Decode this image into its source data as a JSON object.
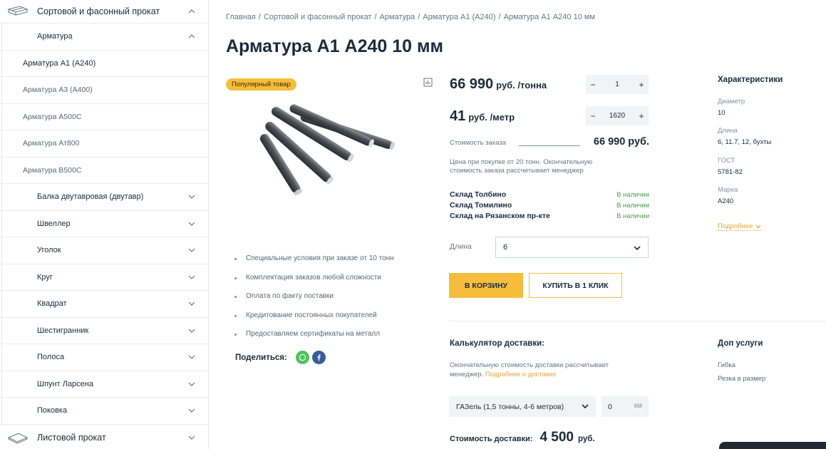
{
  "sidebar": {
    "top_category": "Сортовой и фасонный прокат",
    "sub_open": "Арматура",
    "leaf_items": [
      {
        "label": "Арматура А1 (А240)"
      },
      {
        "label": "Арматура А3 (А400)"
      },
      {
        "label": "Арматура А500С"
      },
      {
        "label": "Арматура Ат800"
      },
      {
        "label": "Арматура В500С"
      }
    ],
    "sub_items": [
      {
        "label": "Балка двутавровая (двутавр)"
      },
      {
        "label": "Швеллер"
      },
      {
        "label": "Уголок"
      },
      {
        "label": "Круг"
      },
      {
        "label": "Квадрат"
      },
      {
        "label": "Шестигранник"
      },
      {
        "label": "Полоса"
      },
      {
        "label": "Шпунт Ларсена"
      },
      {
        "label": "Поковка"
      }
    ],
    "bottom_category": "Листовой прокат"
  },
  "breadcrumbs": [
    "Главная",
    "Сортовой и фасонный прокат",
    "Арматура",
    "Арматура А1 (А240)",
    "Арматура А1 А240 10 мм"
  ],
  "breadcrumb_sep": "/",
  "product": {
    "title": "Арматура А1 А240 10 мм",
    "badge": "Популярный товар",
    "bullets": [
      "Специальные условия при заказе от 10 тонн",
      "Комплектация заказов любой сложности",
      "Оплата по факту поставки",
      "Кредитование постоянных покупателей",
      "Предоставляем сертификаты на металл"
    ],
    "share_label": "Поделиться:"
  },
  "pricing": {
    "price_ton": "66 990",
    "price_ton_unit": "руб. /тонна",
    "price_meter": "41",
    "price_meter_unit": "руб. /метр",
    "qty_ton": "1",
    "qty_meter": "1620",
    "minus": "−",
    "plus": "+",
    "order_cost_label": "Стоимость заказа",
    "order_cost_value": "66 990 руб.",
    "note": "Цена при покупке от 20 тонн. Окончательную стоимость заказа рассчитывает менеджер"
  },
  "stock": [
    {
      "name": "Склад Толбино",
      "status": "В наличии"
    },
    {
      "name": "Склад Томилино",
      "status": "В наличии"
    },
    {
      "name": "Склад на Рязанском пр-кте",
      "status": "В наличии"
    }
  ],
  "length": {
    "label": "Длина",
    "value": "6"
  },
  "actions": {
    "cart": "В КОРЗИНУ",
    "one_click": "КУПИТЬ В 1 КЛИК"
  },
  "specs": {
    "title": "Характеристики",
    "items": [
      {
        "k": "Диаметр",
        "v": "10"
      },
      {
        "k": "Длина",
        "v": "6, 11.7, 12, бухты"
      },
      {
        "k": "ГОСТ",
        "v": "5781-82"
      },
      {
        "k": "Марка",
        "v": "А240"
      }
    ],
    "more": "Подробнее"
  },
  "delivery": {
    "title": "Калькулятор доставки:",
    "note": "Окончательную стоимость доставки рассчитывает менеджер.",
    "note_link": "Подробнее о доставке",
    "vehicle": "ГАЗель (1,5 тонны, 4-6 метров)",
    "km_value": "0",
    "km_unit": "км",
    "cost_label": "Стоимость доставки:",
    "cost_value": "4 500",
    "cost_currency": "руб."
  },
  "extra": {
    "title": "Доп услуги",
    "items": [
      "Гибка",
      "Резка в размер"
    ]
  },
  "colors": {
    "accent": "#f6bd3c",
    "text_dark": "#1a2b3d",
    "in_stock": "#4c9a4c",
    "link": "#e8a43a"
  }
}
